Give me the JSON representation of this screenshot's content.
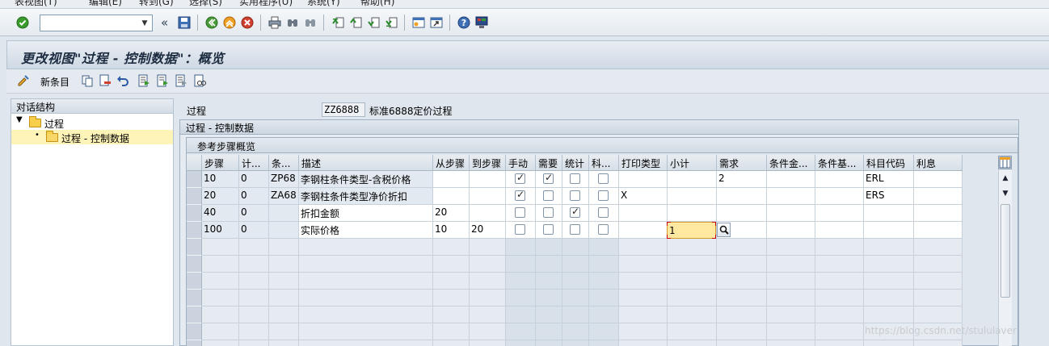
{
  "menu": {
    "items": [
      "表视图(T)",
      "编辑(E)",
      "转到(G)",
      "选择(S)",
      "实用程序(U)",
      "系统(Y)",
      "帮助(H)"
    ]
  },
  "toolbar": {
    "command_value": "",
    "back_glyph": "«",
    "icons": [
      "enter-icon",
      "save-icon",
      "back-icon",
      "exit-icon",
      "cancel-icon",
      "print-icon",
      "find-icon",
      "find-next-icon",
      "first-page-icon",
      "prev-page-icon",
      "next-page-icon",
      "last-page-icon",
      "new-session-icon",
      "shortcut-icon",
      "help-icon",
      "layout-icon"
    ]
  },
  "title": "更改视图\"过程 - 控制数据\"：概览",
  "app_toolbar": {
    "new_entries": "新条目"
  },
  "tree": {
    "header": "对话结构",
    "items": [
      {
        "label": "过程",
        "level": 0,
        "expanded": true
      },
      {
        "label": "过程 - 控制数据",
        "level": 1,
        "selected": true
      }
    ]
  },
  "procedure": {
    "label": "过程",
    "code": "ZZ6888",
    "description": "标准6888定价过程"
  },
  "group_outer_title": "过程 - 控制数据",
  "group_inner_title": "参考步骤概览",
  "table": {
    "columns": [
      "步骤",
      "计...",
      "条...",
      "描述",
      "从步骤",
      "到步骤",
      "手动",
      "需要",
      "统计",
      "科...",
      "打印类型",
      "小计",
      "需求",
      "条件金...",
      "条件基...",
      "科目代码",
      "利息"
    ],
    "rows": [
      {
        "step": "10",
        "counter": "0",
        "ctype": "ZP68",
        "desc": "李钢柱条件类型-含税价格",
        "from": "",
        "to": "",
        "manual": true,
        "required": true,
        "statistical": false,
        "acct": false,
        "print": "",
        "subtotal": "",
        "req": "2",
        "altcalc": "",
        "altbase": "",
        "acctkey": "ERL",
        "accrual": ""
      },
      {
        "step": "20",
        "counter": "0",
        "ctype": "ZA68",
        "desc": "李钢柱条件类型净价折扣",
        "from": "",
        "to": "",
        "manual": true,
        "required": false,
        "statistical": false,
        "acct": false,
        "print": "X",
        "subtotal": "",
        "req": "",
        "altcalc": "",
        "altbase": "",
        "acctkey": "ERS",
        "accrual": ""
      },
      {
        "step": "40",
        "counter": "0",
        "ctype": "",
        "desc": "折扣金额",
        "from": "20",
        "to": "",
        "manual": false,
        "required": false,
        "statistical": true,
        "acct": false,
        "print": "",
        "subtotal": "",
        "req": "",
        "altcalc": "",
        "altbase": "",
        "acctkey": "",
        "accrual": ""
      },
      {
        "step": "100",
        "counter": "0",
        "ctype": "",
        "desc": "实际价格",
        "from": "10",
        "to": "20",
        "manual": false,
        "required": false,
        "statistical": false,
        "acct": false,
        "print": "",
        "subtotal": "1",
        "req": "",
        "altcalc": "",
        "altbase": "",
        "acctkey": "",
        "accrual": ""
      }
    ],
    "empty_rows": 7
  },
  "watermark": "https://blog.csdn.net/stululaver",
  "colors": {
    "accent_blue": "#0a3c8c",
    "selection_yellow": "#fff4b8",
    "focus_field": "#ffe9a0",
    "enter_green": "#3a9a2c",
    "cancel_red": "#d04030"
  }
}
